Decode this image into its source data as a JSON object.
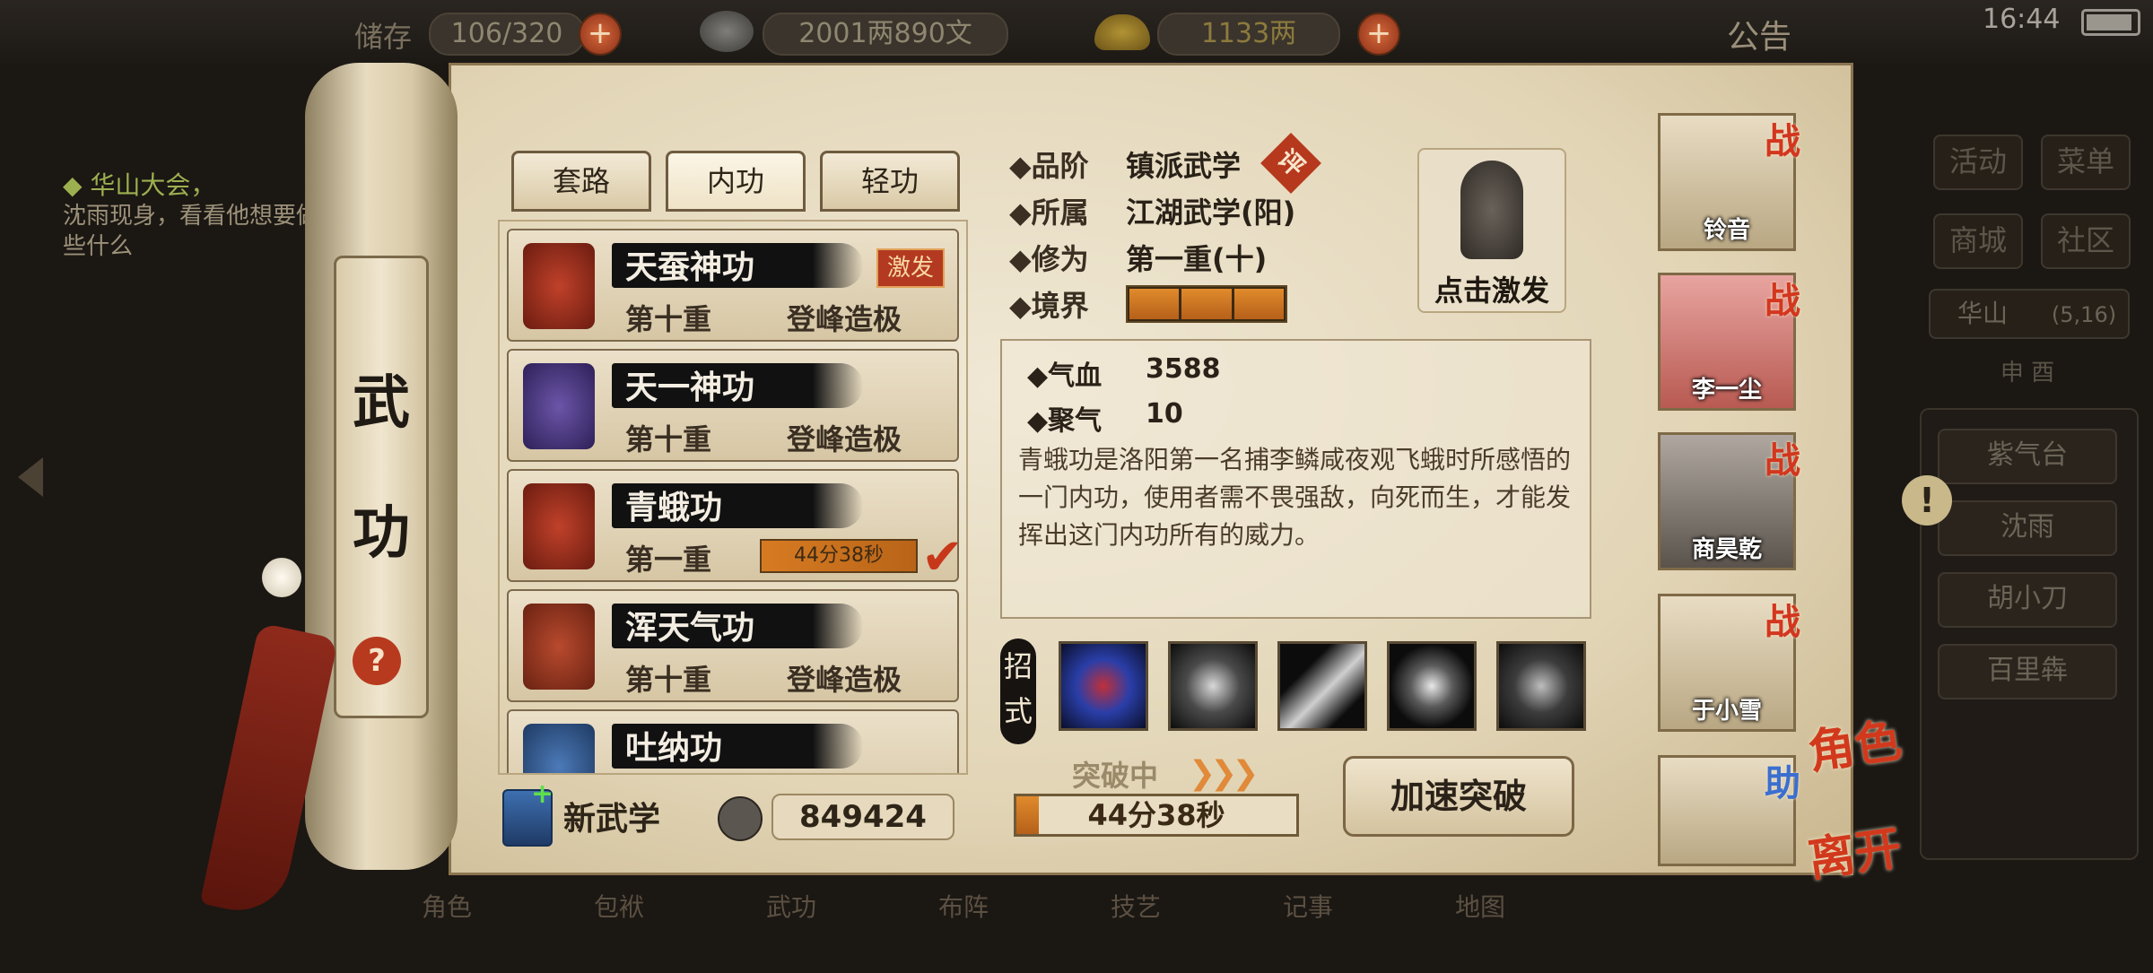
{
  "status": {
    "time": "16:44",
    "storage": "106/320",
    "money": "2001两890文",
    "gold": "1133两",
    "notice": "公告",
    "storage_label": "储存"
  },
  "quest": {
    "title": "◆ 华山大会，",
    "text": "沈雨现身，看看他想要做些什么"
  },
  "right_menu": {
    "buttons": [
      "活动",
      "菜单",
      "商城",
      "社区"
    ],
    "location": "华山",
    "coords": "(5,16)",
    "time_of_day": "申 酉",
    "places": [
      "紫气台",
      "沈雨",
      "胡小刀",
      "百里犇"
    ]
  },
  "panel_title": [
    "武",
    "功"
  ],
  "tabs": [
    "套路",
    "内功",
    "轻功"
  ],
  "skills": [
    {
      "name": "天蚕神功",
      "level": "第十重",
      "status": "登峰造极",
      "badge": "激发"
    },
    {
      "name": "天一神功",
      "level": "第十重",
      "status": "登峰造极"
    },
    {
      "name": "青蛾功",
      "level": "第一重",
      "timer": "44分38秒"
    },
    {
      "name": "浑天气功",
      "level": "第十重",
      "status": "登峰造极"
    },
    {
      "name": "吐纳功",
      "level": "",
      "status": ""
    }
  ],
  "new_skill_label": "新武学",
  "points": "849424",
  "detail": {
    "grade_label": "◆品阶",
    "grade": "镇派武学",
    "grade_badge": "评",
    "belong_label": "◆所属",
    "belong": "江湖武学(阳)",
    "cultivation_label": "◆修为",
    "cultivation": "第一重(十)",
    "realm_label": "◆境界",
    "realm_progress": 3,
    "activate_label": "点击激发",
    "hp_label": "◆气血",
    "hp": "3588",
    "qi_label": "◆聚气",
    "qi": "10",
    "description": "青蛾功是洛阳第一名捕李鳞咸夜观飞蛾时所感悟的一门内功，使用者需不畏强敌，向死而生，才能发挥出这门内功所有的威力。",
    "moves_label": "招式",
    "breakthrough_label": "突破中",
    "breakthrough_timer": "44分38秒",
    "breakthrough_progress": 0.08,
    "speedup_label": "加速突破"
  },
  "party": [
    {
      "name": "铃音",
      "tag": "战"
    },
    {
      "name": "李一尘",
      "tag": "战"
    },
    {
      "name": "商昊乾",
      "tag": "战"
    },
    {
      "name": "于小雪",
      "tag": "战"
    },
    {
      "name": "",
      "tag": "助"
    }
  ],
  "side_labels": {
    "role": "角色",
    "leave": "离开"
  },
  "bottom_nav": [
    "角色",
    "包袱",
    "武功",
    "布阵",
    "技艺",
    "记事",
    "地图"
  ],
  "colors": {
    "accent_red": "#b83a1e",
    "timer_orange": "#d77b22",
    "paper": "#e8dcc3"
  }
}
